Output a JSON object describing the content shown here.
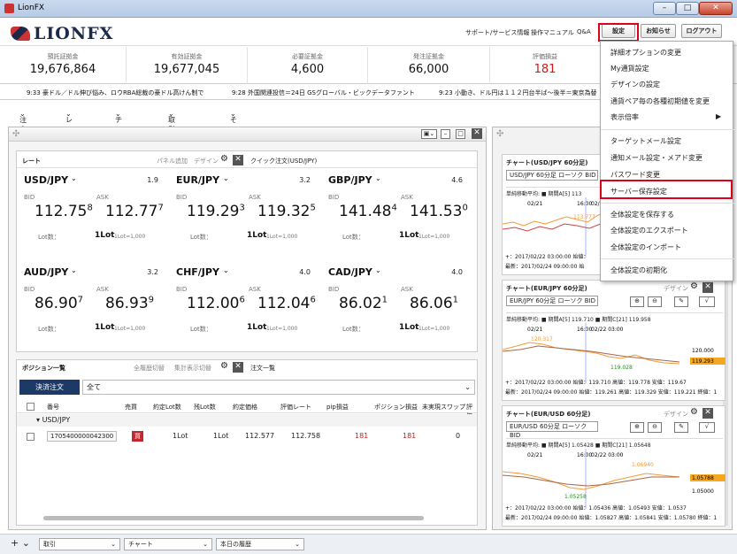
{
  "window": {
    "title": "LionFX",
    "min": "–",
    "max": "□",
    "close": "✕"
  },
  "header": {
    "logo": "LIONFX",
    "links": [
      "サポート/サービス情報",
      "操作マニュアル",
      "Q&A"
    ],
    "buttons": {
      "settings": "設定",
      "notice": "お知らせ",
      "logout": "ログアウト"
    }
  },
  "summary": [
    {
      "label": "預託証拠金",
      "value": "19,676,864"
    },
    {
      "label": "有効証拠金",
      "value": "19,677,045"
    },
    {
      "label": "必要証拠金",
      "value": "4,600"
    },
    {
      "label": "発注証拠金",
      "value": "66,000"
    },
    {
      "label": "評価損益",
      "value": "181"
    }
  ],
  "ticker": [
    "9:33 豪ドル／ドル伸び悩み、ロウRBA総裁の豪ドル高けん制で",
    "9:28 外国関連投信＝24日 GSグローバル・ビックデータファント",
    "9:23 小動き、ドル円は１１２円台半ば～後半＝東京為替"
  ],
  "menu": [
    "注文",
    "レート",
    "チャート",
    "取引情報",
    "その他情報"
  ],
  "rate_panel": {
    "title": "レート",
    "add": "パネル追加",
    "design": "デザイン",
    "quick_order": "クイック注文(USD/JPY)",
    "bid_label": "BID",
    "ask_label": "ASK",
    "lot_label": "Lot数：",
    "lot_value": "1Lot",
    "lot_note": "1Lot=1,000",
    "tiles": [
      {
        "pair": "USD/JPY",
        "spread": "1.9",
        "bid_main": "112.75",
        "bid_small": "8",
        "ask_main": "112.77",
        "ask_small": "7"
      },
      {
        "pair": "EUR/JPY",
        "spread": "3.2",
        "bid_main": "119.29",
        "bid_small": "3",
        "ask_main": "119.32",
        "ask_small": "5"
      },
      {
        "pair": "GBP/JPY",
        "spread": "4.6",
        "bid_main": "141.48",
        "bid_small": "4",
        "ask_main": "141.53",
        "ask_small": "0"
      },
      {
        "pair": "AUD/JPY",
        "spread": "3.2",
        "bid_main": "86.90",
        "bid_small": "7",
        "ask_main": "86.93",
        "ask_small": "9"
      },
      {
        "pair": "CHF/JPY",
        "spread": "4.0",
        "bid_main": "112.00",
        "bid_small": "6",
        "ask_main": "112.04",
        "ask_small": "6"
      },
      {
        "pair": "CAD/JPY",
        "spread": "4.0",
        "bid_main": "86.02",
        "bid_small": "1",
        "ask_main": "86.06",
        "ask_small": "1"
      }
    ]
  },
  "positions": {
    "title": "ポジション一覧",
    "cancel_all": "全履歴切替",
    "agg": "集計表示切替",
    "order_list": "注文一覧",
    "settle_btn": "決済注文",
    "filter": "全て",
    "columns": [
      "番号",
      "売買",
      "約定Lot数",
      "残Lot数",
      "約定価格",
      "評価レート",
      "pip損益",
      "ポジション損益",
      "未実現スワップ",
      "評価"
    ],
    "group": "USD/JPY",
    "rows": [
      {
        "id": "1705400000042300",
        "side": "買",
        "lot": "1Lot",
        "remain": "1Lot",
        "price": "112.577",
        "rate": "112.758",
        "pip": "181",
        "pl": "181",
        "swap": "0"
      }
    ]
  },
  "charts": [
    {
      "title": "チャート(USD/JPY 60分足)",
      "select": "USD/JPY 60分足 ローソク BID",
      "legend": "単純移動平均:  ■ 期間A[5] 113",
      "dates": [
        "02/21",
        "16:00",
        "02/22 03:00"
      ],
      "marks": [
        "113.777"
      ],
      "foot1": "+：2017/02/22 03:00:00 始値：",
      "foot2": "最新：2017/02/24 09:00:00 始"
    },
    {
      "title": "チャート(EUR/JPY 60分足)",
      "design": "デザイン",
      "select": "EUR/JPY 60分足 ローソク BID",
      "legend": "単純移動平均:  ■ 期間A[5] 119.710  ■ 期間C[21] 119.958",
      "dates": [
        "02/21",
        "16:00",
        "02/22 03:00"
      ],
      "marks": [
        "120.317",
        "119.028"
      ],
      "yticks": [
        "120.000",
        "119.293"
      ],
      "foot1": "+：2017/02/22 03:00:00 始値：119.710 高値：119.778 安値：119.67",
      "foot2": "最新：2017/02/24 09:00:00 始値：119.261 高値：119.329 安値：119.221 終値：1"
    },
    {
      "title": "チャート(EUR/USD 60分足)",
      "design": "デザイン",
      "select": "EUR/USD 60分足 ローソク BID",
      "legend": "単純移動平均:  ■ 期間A[5] 1.05428  ■ 期間C[21] 1.05648",
      "dates": [
        "02/21",
        "16:00",
        "02/22 03:00"
      ],
      "marks": [
        "1.06940",
        "1.05258"
      ],
      "yticks": [
        "1.05788",
        "1.05000"
      ],
      "foot1": "+：2017/02/22 03:00:00 始値：1.05436 高値：1.05493 安値：1.0537",
      "foot2": "最新：2017/02/24 09:00:00 始値：1.05827 高値：1.05841 安値：1.05780 終値：1"
    }
  ],
  "dropdown": [
    "詳細オプションの変更",
    "My通貨設定",
    "デザインの設定",
    "通貨ペア毎の各種初期値を変更",
    "表示倍率",
    "ターゲットメール設定",
    "通知メール設定・メアド変更",
    "パスワード変更",
    "サーバー保存設定",
    "全体設定を保存する",
    "全体設定のエクスポート",
    "全体設定のインポート",
    "全体設定の初期化"
  ],
  "statusbar": {
    "add": "+",
    "tabs": [
      "取引",
      "チャート",
      "本日の履歴"
    ]
  },
  "colors": {
    "accent": "#e0001c",
    "navy": "#1b3a66",
    "loss": "#d01818"
  }
}
